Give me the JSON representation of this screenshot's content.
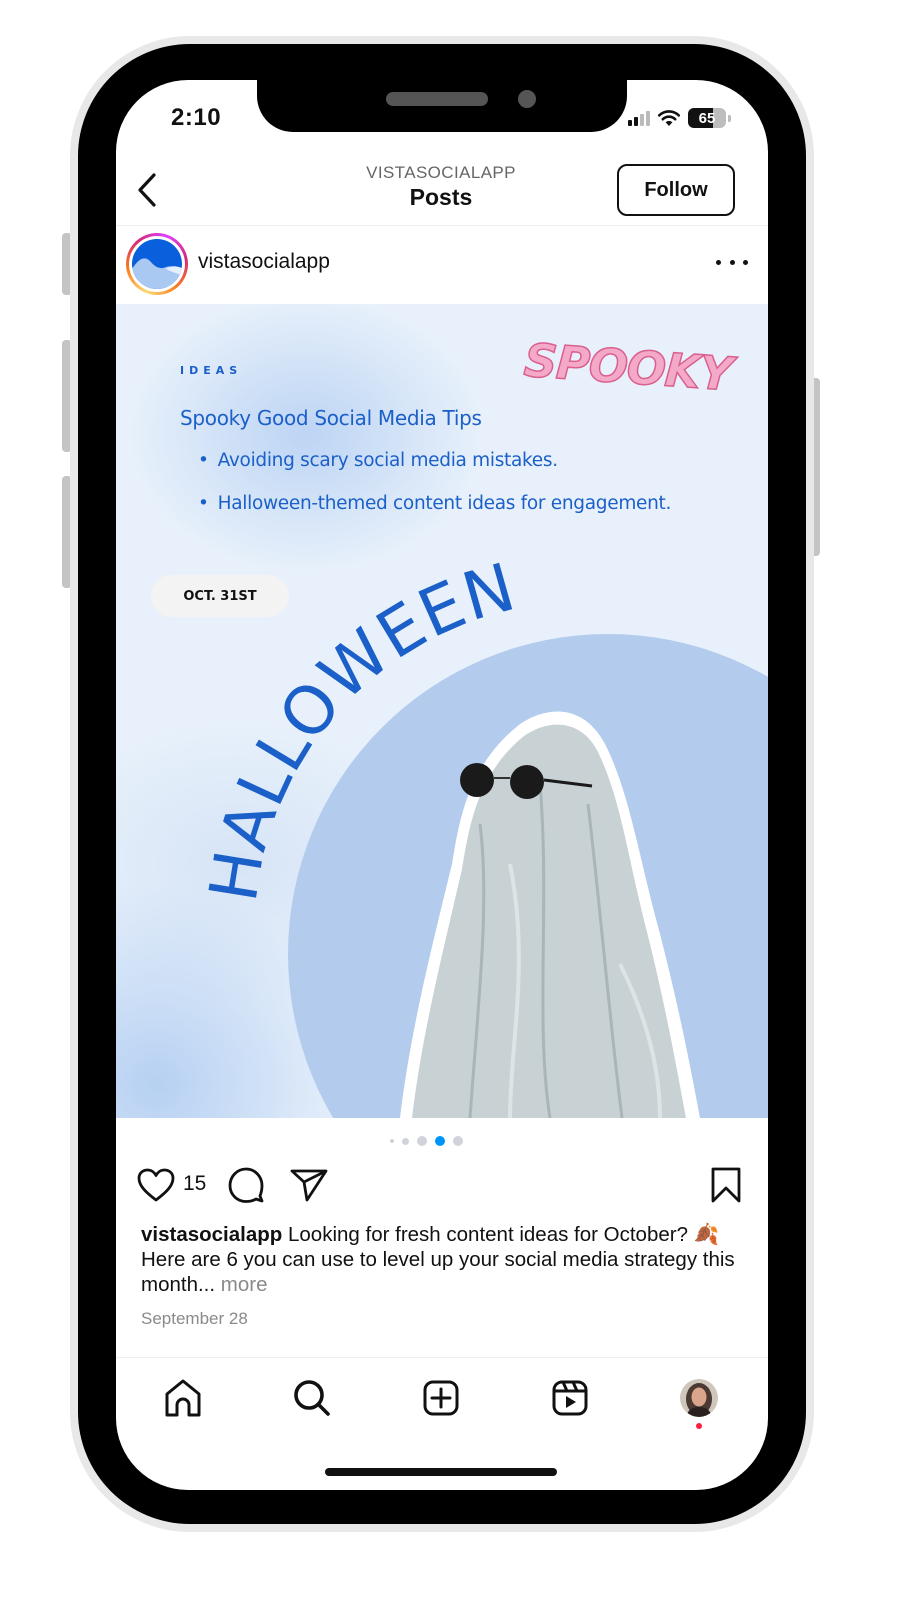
{
  "status_bar": {
    "time": "2:10",
    "battery_level": "65",
    "battery_fraction": 0.65,
    "signal_bars_active": 2,
    "signal_bars_total": 4
  },
  "header": {
    "subtitle": "VISTASOCIALAPP",
    "title": "Posts",
    "back_icon": "chevron-left-icon",
    "follow_label": "Follow"
  },
  "post": {
    "username": "vistasocialapp",
    "more_icon": "more-horizontal-icon",
    "image": {
      "ideas_label": "IDEAS",
      "spooky_word": "SPOOKY",
      "tips_title": "Spooky Good Social Media Tips",
      "tips": [
        "Avoiding scary social media mistakes.",
        "Halloween-themed content ideas for engagement."
      ],
      "date_pill": "OCT. 31ST",
      "headline": "HALLOWEEN",
      "accent_color": "#1b5fc9",
      "circle_color": "#b3cced"
    },
    "carousel": {
      "total": 5,
      "active_index": 3,
      "active_color": "#0095f6"
    },
    "actions": {
      "like_icon": "heart-icon",
      "like_count": "15",
      "comment_icon": "comment-icon",
      "share_icon": "send-icon",
      "save_icon": "bookmark-icon"
    },
    "caption": {
      "username": "vistasocialapp",
      "text_before_emoji": "Looking for fresh content ideas for October?",
      "emoji": "🍂",
      "text_after_emoji": "Here are 6 you can use to level up your social media strategy this month...",
      "more_label": "more"
    },
    "date": "September 28"
  },
  "bottom_nav": {
    "items": [
      {
        "name": "home",
        "icon": "home-icon"
      },
      {
        "name": "search",
        "icon": "search-icon"
      },
      {
        "name": "create",
        "icon": "plus-square-icon"
      },
      {
        "name": "reels",
        "icon": "reels-icon"
      },
      {
        "name": "profile",
        "icon": "profile-avatar"
      }
    ],
    "notification_dot_color": "#ff1f3d"
  }
}
